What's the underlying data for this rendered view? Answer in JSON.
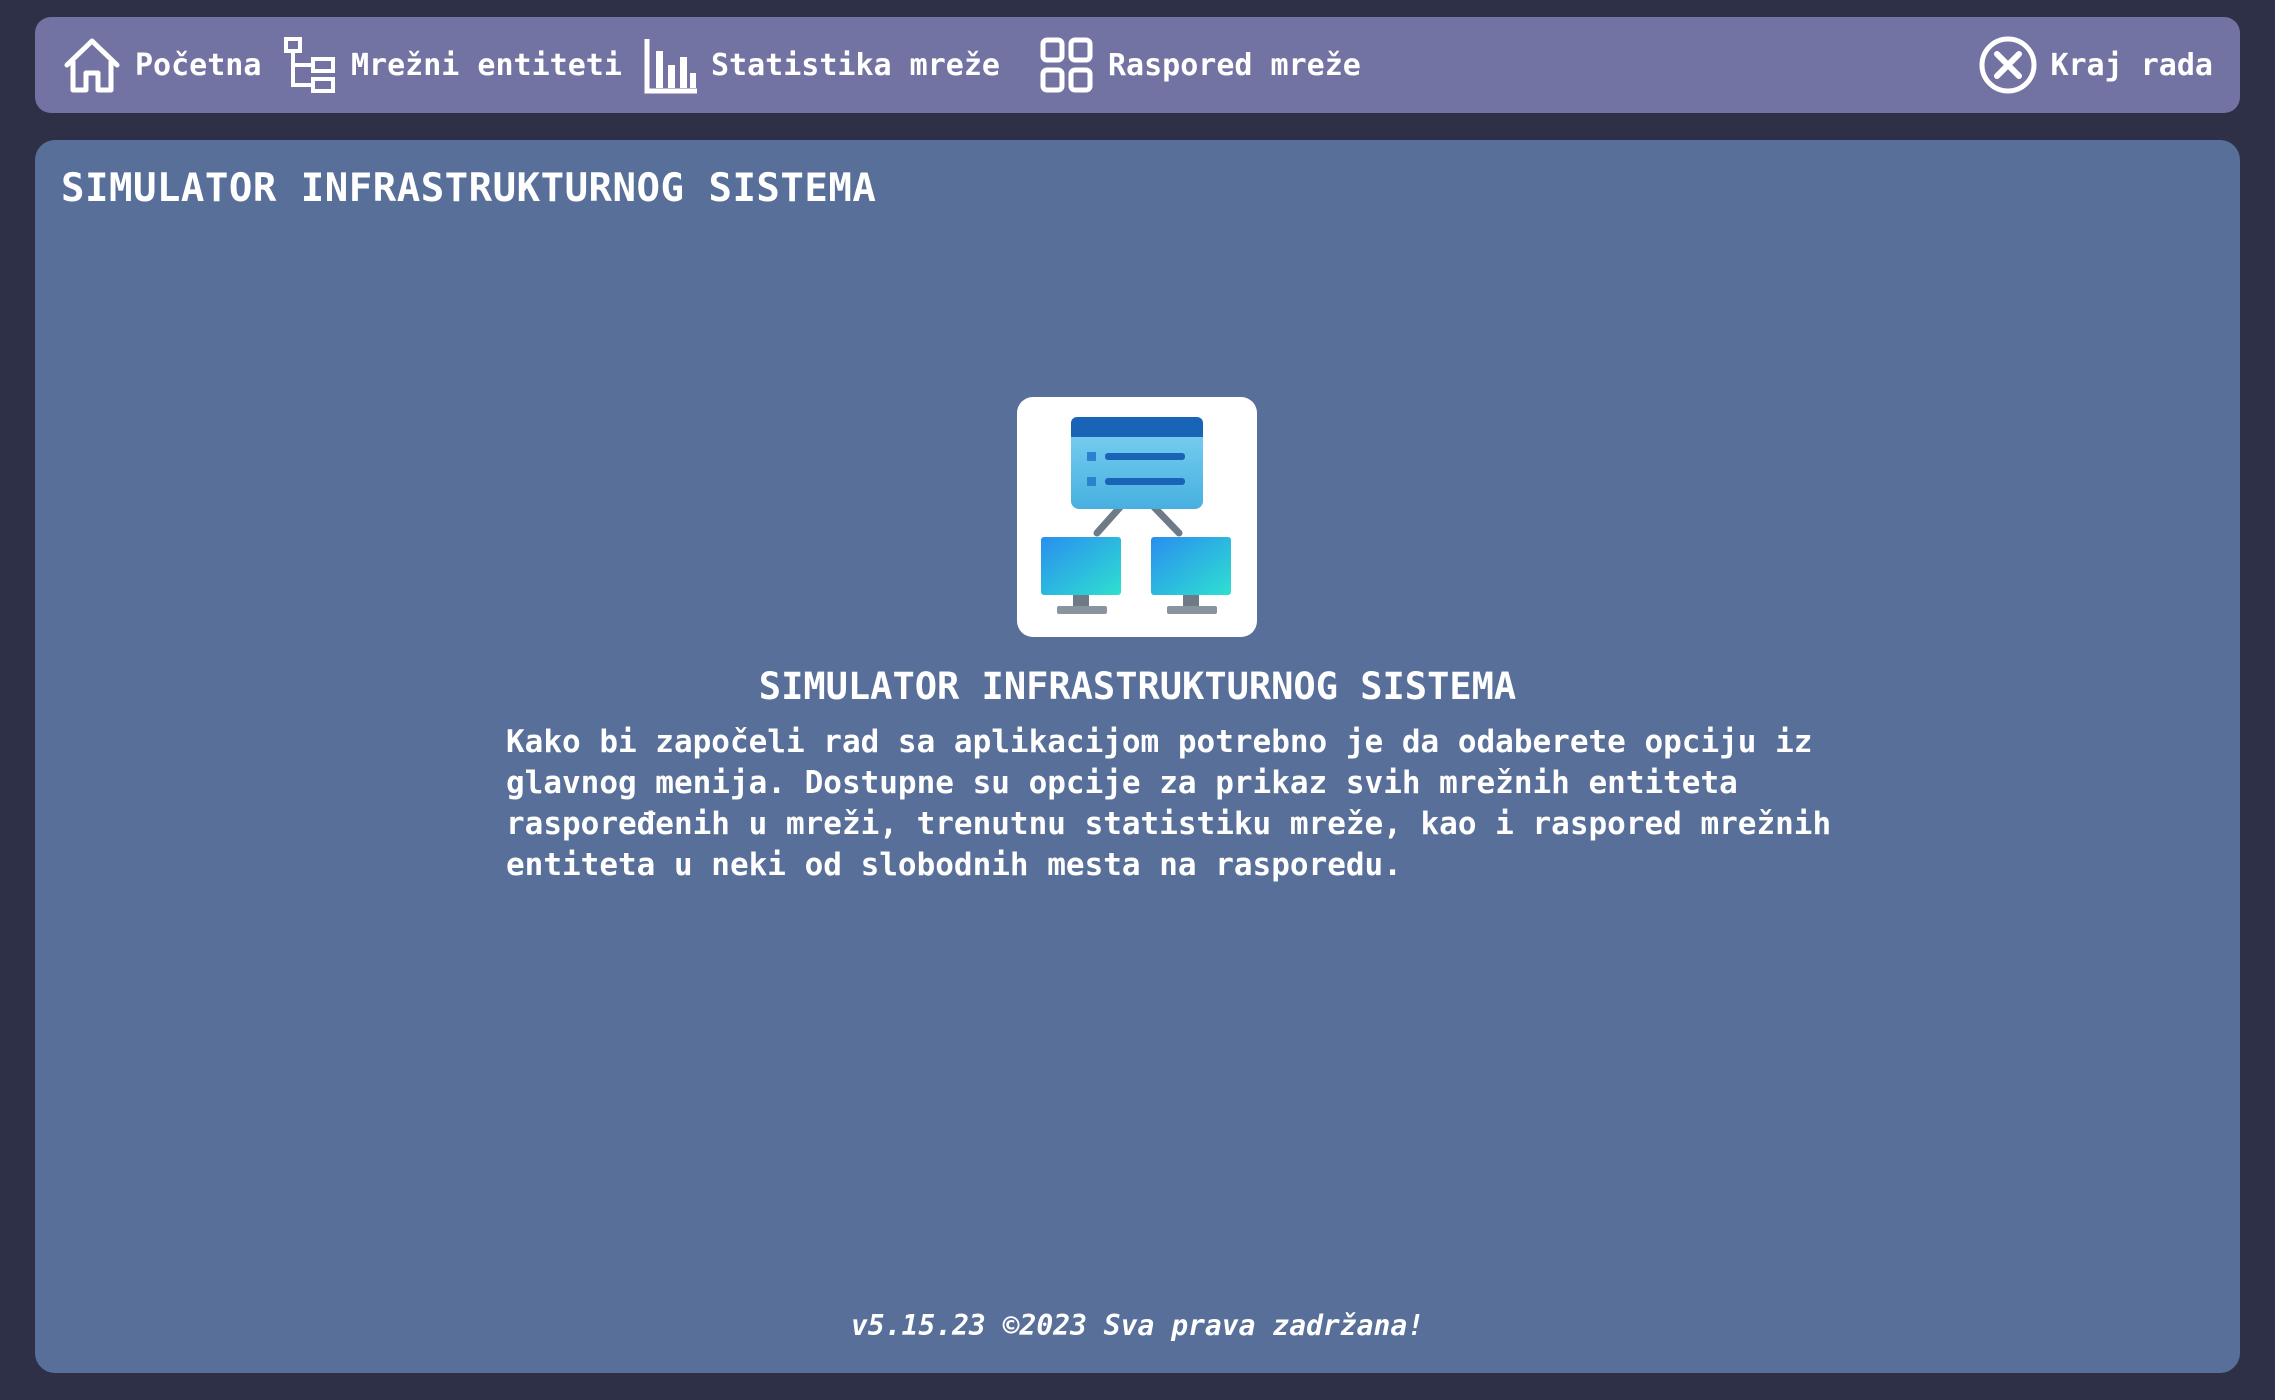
{
  "nav": {
    "home_label": "Početna",
    "entities_label": "Mrežni entiteti",
    "stats_label": "Statistika mreže",
    "layout_label": "Raspored mreže",
    "exit_label": "Kraj rada",
    "icons": {
      "home": "home-icon",
      "entities": "tree-structure-icon",
      "stats": "bar-chart-icon",
      "layout": "grid-icon",
      "exit": "close-circle-icon"
    }
  },
  "main": {
    "page_title": "SIMULATOR INFRASTRUKTURNOG SISTEMA",
    "hero_icon": "network-server-icon",
    "hero_title": "SIMULATOR INFRASTRUKTURNOG SISTEMA",
    "hero_description": "Kako bi započeli rad sa aplikacijom potrebno je da odaberete opciju iz glavnog menija. Dostupne su opcije za prikaz svih mrežnih entiteta raspoređenih u mreži, trenutnu statistiku mreže, kao i raspored mrežnih entiteta u neki od slobodnih mesta na rasporedu."
  },
  "footer": {
    "text": "v5.15.23 ©2023 Sva prava zadržana!"
  },
  "colors": {
    "background": "#2e3047",
    "navbar": "#7373a3",
    "main_panel": "#586f99",
    "text": "#ffffff"
  }
}
